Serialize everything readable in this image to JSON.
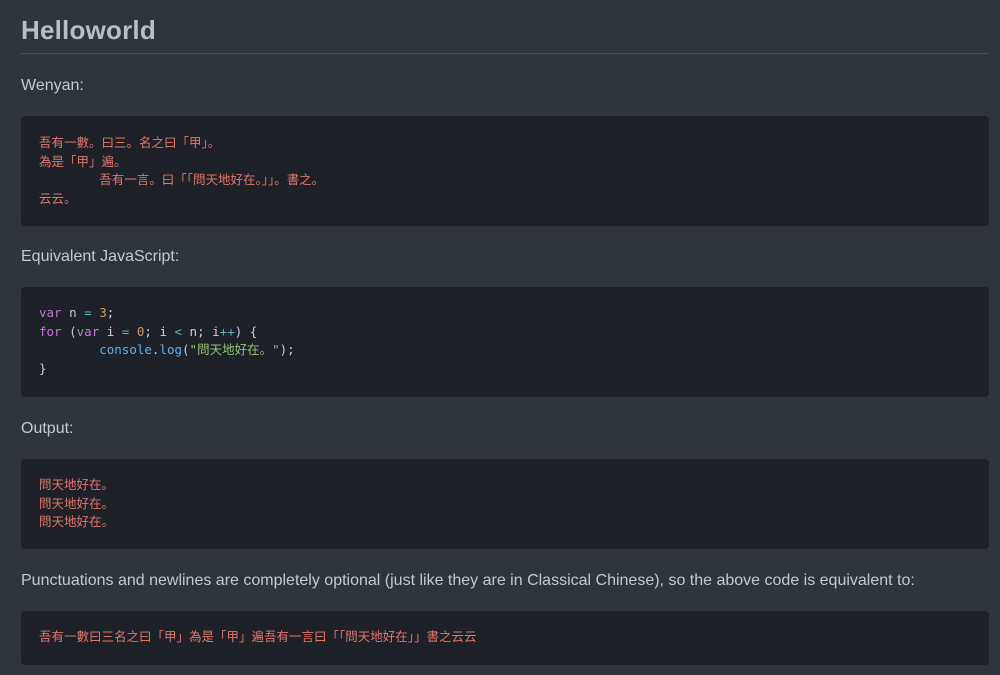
{
  "page": {
    "title": "Helloworld",
    "wenyan_label": "Wenyan:",
    "js_label": "Equivalent JavaScript:",
    "output_label": "Output:",
    "note": "Punctuations and newlines are completely optional (just like they are in Classical Chinese), so the above code is equivalent to:"
  },
  "wenyan_code": {
    "lines": [
      "吾有一數。曰三。名之曰「甲」。",
      "為是「甲」遍。",
      "        吾有一言。曰「「問天地好在。」」。書之。",
      "云云。"
    ]
  },
  "js_code": {
    "line1": {
      "kw": "var",
      "name": " n ",
      "op": "=",
      "num": " 3",
      "end": ";"
    },
    "line2": {
      "kw": "for",
      "p1": " (",
      "kw2": "var",
      "p2": " i ",
      "op1": "=",
      "num": " 0",
      "p3": "; i ",
      "op2": "<",
      "p4": " n; i",
      "op3": "++",
      "p5": ") {"
    },
    "line3": {
      "indent": "        ",
      "obj": "console",
      "dot": ".",
      "fn": "log",
      "p1": "(",
      "str": "\"問天地好在。\"",
      "p2": ");"
    },
    "line4": {
      "close": "}"
    }
  },
  "output_code": {
    "lines": [
      "問天地好在。",
      "問天地好在。",
      "問天地好在。"
    ]
  },
  "compact_code": {
    "line": "吾有一數曰三名之曰「甲」為是「甲」遍吾有一言曰「「問天地好在」」書之云云"
  }
}
